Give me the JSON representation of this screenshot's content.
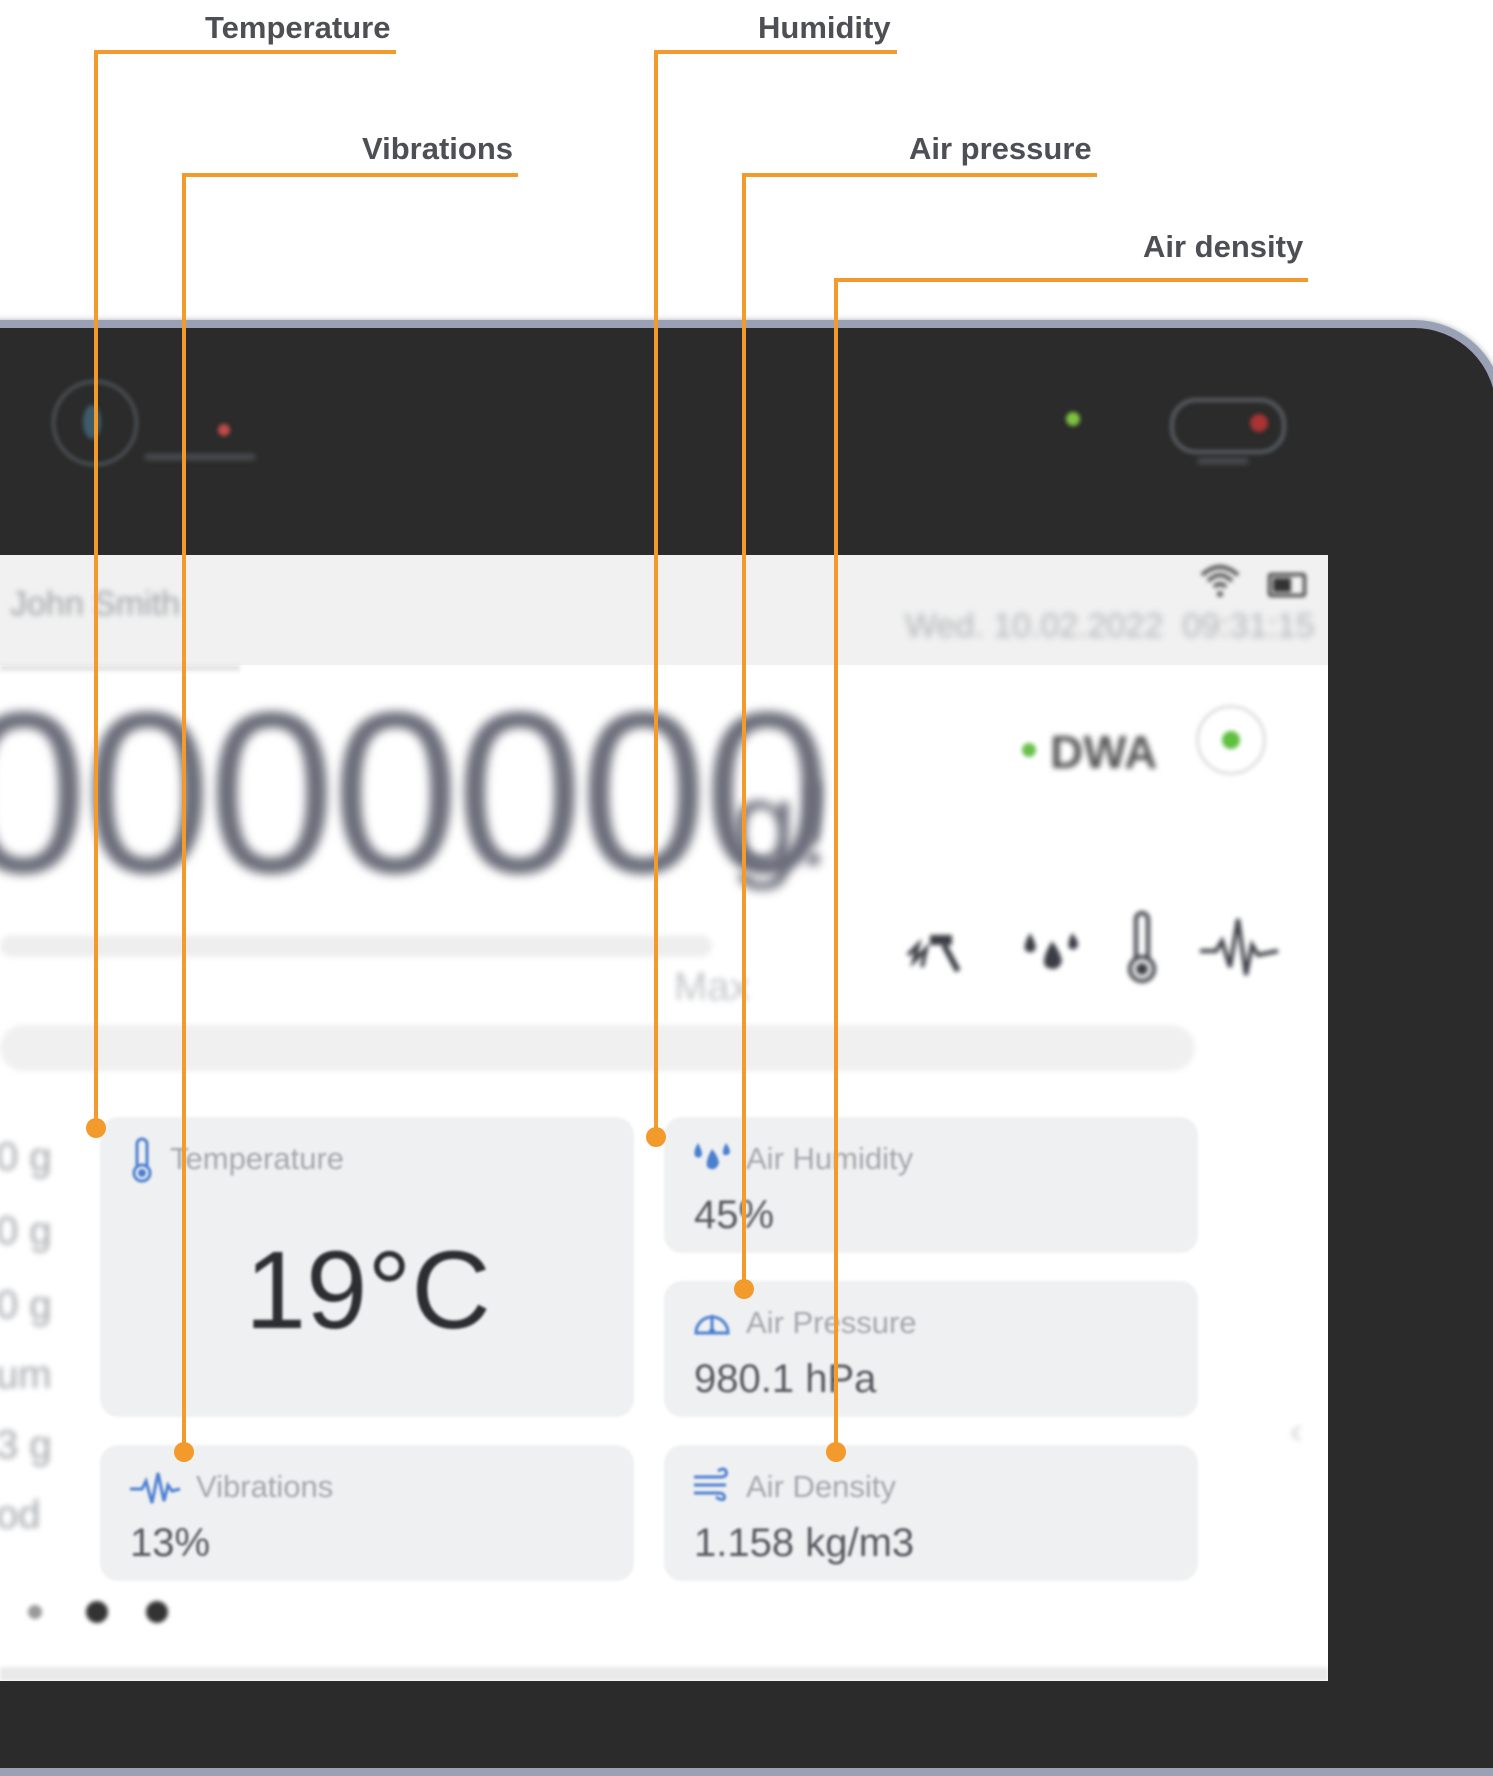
{
  "callouts": {
    "temperature": "Temperature",
    "humidity": "Humidity",
    "vibrations": "Vibrations",
    "air_pressure": "Air pressure",
    "air_density": "Air density"
  },
  "colors": {
    "callout_orange": "#f39a2c",
    "bezel": "#2a2b2a",
    "card_bg": "#eff0f1",
    "icon_blue": "#4a7fd0",
    "status_green": "#67c04a"
  },
  "status_bar": {
    "user_name": "John Smith",
    "date": "Wed. 10.02.2022",
    "time": "09:31:15",
    "icons": [
      "wifi-icon",
      "battery-icon"
    ]
  },
  "scale": {
    "weight_display": "0000000",
    "unit": "g!",
    "max_label": "Max",
    "mode_label": "DWA",
    "sensor_icons": [
      "shock-icon",
      "droplets-icon",
      "thermometer-icon",
      "vibration-icon"
    ]
  },
  "side_list": [
    "0 g",
    "0 g",
    "0 g",
    "um",
    "3 g",
    "od"
  ],
  "cards": {
    "temperature": {
      "title": "Temperature",
      "value": "19°C",
      "icon": "thermometer-icon"
    },
    "vibrations": {
      "title": "Vibrations",
      "value": "13%",
      "icon": "vibration-icon"
    },
    "air_humidity": {
      "title": "Air Humidity",
      "value": "45%",
      "icon": "droplets-icon"
    },
    "air_pressure": {
      "title": "Air Pressure",
      "value": "980.1 hPa",
      "icon": "gauge-icon"
    },
    "air_density": {
      "title": "Air Density",
      "value": "1.158 kg/m3",
      "icon": "wind-icon"
    }
  }
}
